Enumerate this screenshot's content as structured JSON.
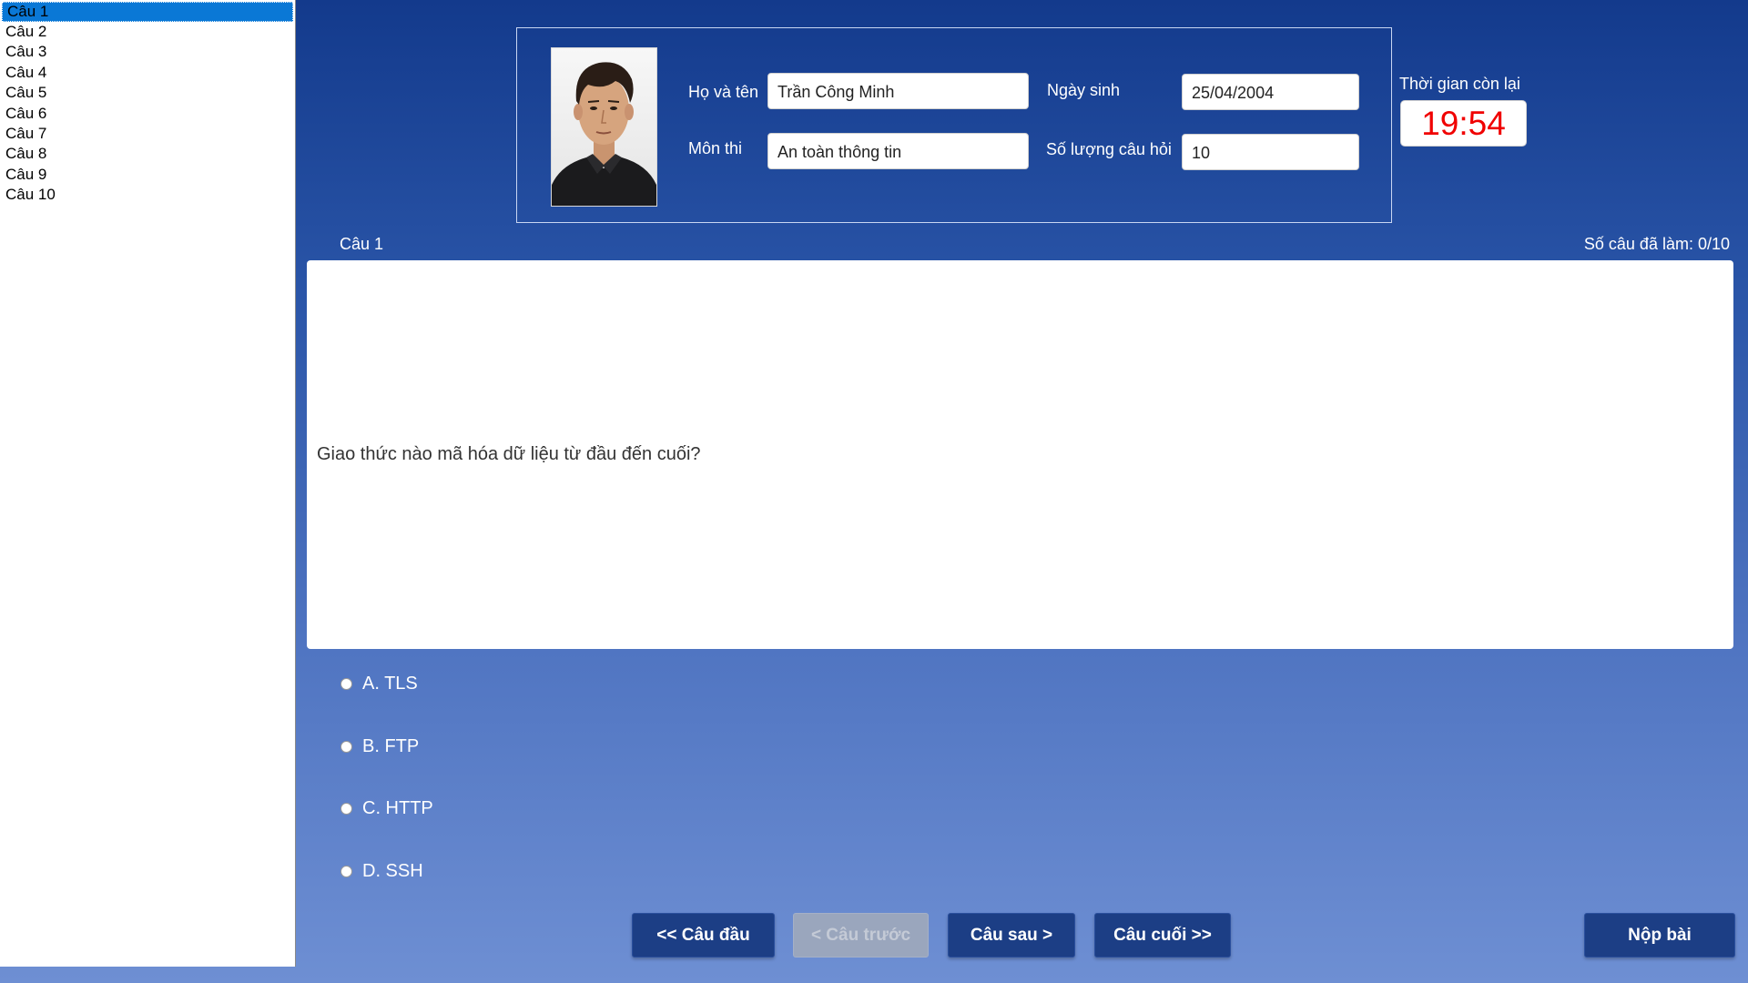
{
  "question_list": [
    "Câu 1",
    "Câu 2",
    "Câu 3",
    "Câu 4",
    "Câu 5",
    "Câu 6",
    "Câu 7",
    "Câu 8",
    "Câu 9",
    "Câu 10"
  ],
  "selected_index": 0,
  "student": {
    "name_label": "Họ và tên",
    "name_value": "Trần Công Minh",
    "dob_label": "Ngày sinh",
    "dob_value": "25/04/2004",
    "subject_label": "Môn thi",
    "subject_value": "An toàn thông tin",
    "count_label": "Số lượng câu hỏi",
    "count_value": "10"
  },
  "timer": {
    "label": "Thời gian còn lại",
    "value": "19:54",
    "color": "#f00000"
  },
  "question": {
    "label": "Câu 1",
    "progress": "Số câu đã làm: 0/10",
    "text": "Giao thức nào mã hóa dữ liệu từ đầu đến cuối?",
    "options": [
      "A. TLS",
      "B. FTP",
      "C. HTTP",
      "D. SSH"
    ]
  },
  "buttons": {
    "first": "<< Câu đầu",
    "prev": "< Câu trước",
    "next": "Câu sau >",
    "last": "Câu cuối >>",
    "submit": "Nộp bài"
  },
  "colors": {
    "accent": "#0a78d6",
    "button": "#1c3e85"
  }
}
